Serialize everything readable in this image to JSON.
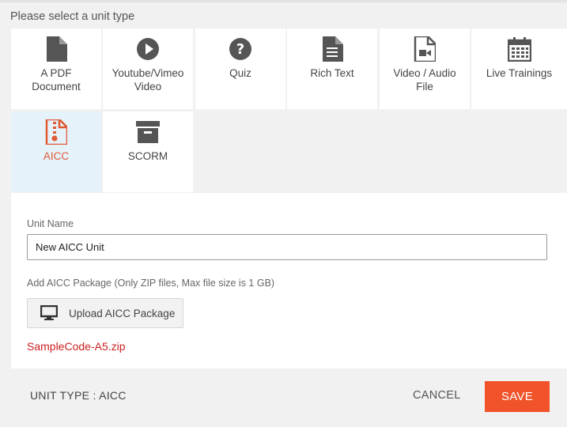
{
  "heading": "Please select a unit type",
  "unit_types": [
    {
      "label": "A PDF\nDocument",
      "icon": "pdf-document-icon"
    },
    {
      "label": "Youtube/Vimeo\nVideo",
      "icon": "play-icon"
    },
    {
      "label": "Quiz",
      "icon": "question-icon"
    },
    {
      "label": "Rich Text",
      "icon": "rich-text-icon"
    },
    {
      "label": "Video / Audio\nFile",
      "icon": "video-file-icon"
    },
    {
      "label": "Live Trainings",
      "icon": "calendar-icon"
    },
    {
      "label": "AICC",
      "icon": "zip-file-icon",
      "selected": true
    },
    {
      "label": "SCORM",
      "icon": "archive-box-icon"
    }
  ],
  "form": {
    "unit_name_label": "Unit Name",
    "unit_name_value": "New AICC Unit",
    "package_label": "Add AICC Package (Only ZIP files, Max file size is 1 GB)",
    "upload_button_label": "Upload AICC Package",
    "uploaded_file": "SampleCode-A5.zip"
  },
  "footer": {
    "unit_type_text": "UNIT TYPE : AICC",
    "cancel_label": "CANCEL",
    "save_label": "SAVE"
  },
  "colors": {
    "accent": "#f0532a",
    "selected_tile_bg": "#e6f2fa",
    "selected_label": "#e05a35",
    "file_name": "#cc1f1f",
    "icon": "#555555"
  }
}
